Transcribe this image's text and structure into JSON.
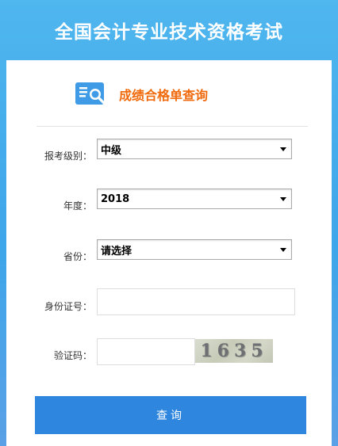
{
  "header": {
    "title": "全国会计专业技术资格考试"
  },
  "subtitle": {
    "text": "成绩合格单查询",
    "icon": "search-document-icon"
  },
  "form": {
    "level": {
      "label": "报考级别：",
      "value": "中级"
    },
    "year": {
      "label": "年度：",
      "value": "2018"
    },
    "province": {
      "label": "省份：",
      "value": "请选择"
    },
    "id_number": {
      "label": "身份证号：",
      "value": ""
    },
    "captcha": {
      "label": "验证码：",
      "value": "",
      "code": "1635"
    }
  },
  "button": {
    "query_label": "查询"
  },
  "colors": {
    "header_bg": "#4fb6ee",
    "accent_orange": "#f06a0c",
    "button_bg": "#2f86de"
  }
}
